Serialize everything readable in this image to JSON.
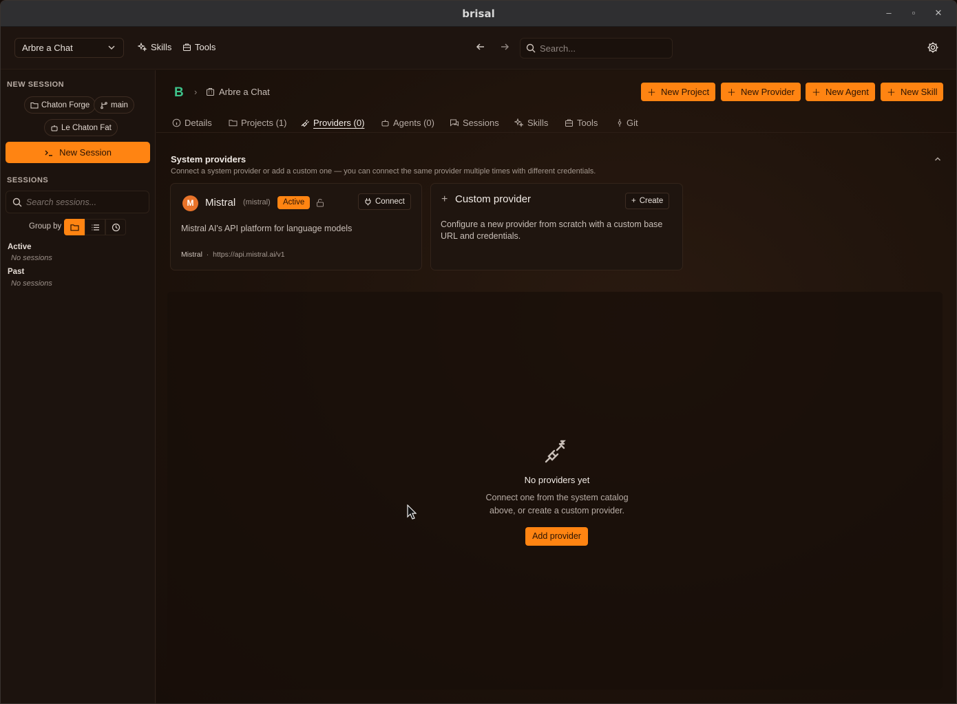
{
  "window": {
    "title": "brisal",
    "min": "–",
    "max": "▫",
    "close": "✕"
  },
  "toolbar": {
    "project_select": "Arbre a Chat",
    "skills": "Skills",
    "tools": "Tools",
    "search_placeholder": "Search..."
  },
  "sidebar": {
    "new_session_label": "NEW SESSION",
    "chips": [
      "Chaton Forge",
      "main",
      "Le Chaton Fat"
    ],
    "new_session_button": "New Session",
    "sessions_label": "SESSIONS",
    "search_placeholder": "Search sessions...",
    "group_by": "Group by",
    "groups": [
      {
        "title": "Active",
        "empty": "No sessions"
      },
      {
        "title": "Past",
        "empty": "No sessions"
      }
    ]
  },
  "main": {
    "breadcrumb": "Arbre a Chat",
    "header_buttons": [
      "New Project",
      "New Provider",
      "New Agent",
      "New Skill"
    ],
    "tabs": [
      {
        "label": "Details"
      },
      {
        "label": "Projects (1)"
      },
      {
        "label": "Providers (0)"
      },
      {
        "label": "Agents (0)"
      },
      {
        "label": "Sessions"
      },
      {
        "label": "Skills"
      },
      {
        "label": "Tools"
      },
      {
        "label": "Git"
      }
    ],
    "system_providers": {
      "title": "System providers",
      "subtitle": "Connect a system provider or add a custom one — you can connect the same provider multiple times with different credentials."
    },
    "mistral": {
      "avatar": "M",
      "name": "Mistral",
      "id": "(mistral)",
      "badge": "Active",
      "connect": "Connect",
      "description": "Mistral AI's API platform for language models",
      "vendor": "Mistral",
      "separator": "·",
      "url": "https://api.mistral.ai/v1"
    },
    "custom": {
      "plus": "+",
      "title": "Custom provider",
      "create": "Create",
      "description": "Configure a new provider from scratch with a custom base URL and credentials."
    },
    "empty": {
      "title": "No providers yet",
      "line1": "Connect one from the system catalog",
      "line2": "above, or create a custom provider.",
      "button": "Add provider"
    }
  },
  "colors": {
    "accent": "#ff8412",
    "logo": "#3ec28a",
    "background": "#1a110c"
  }
}
